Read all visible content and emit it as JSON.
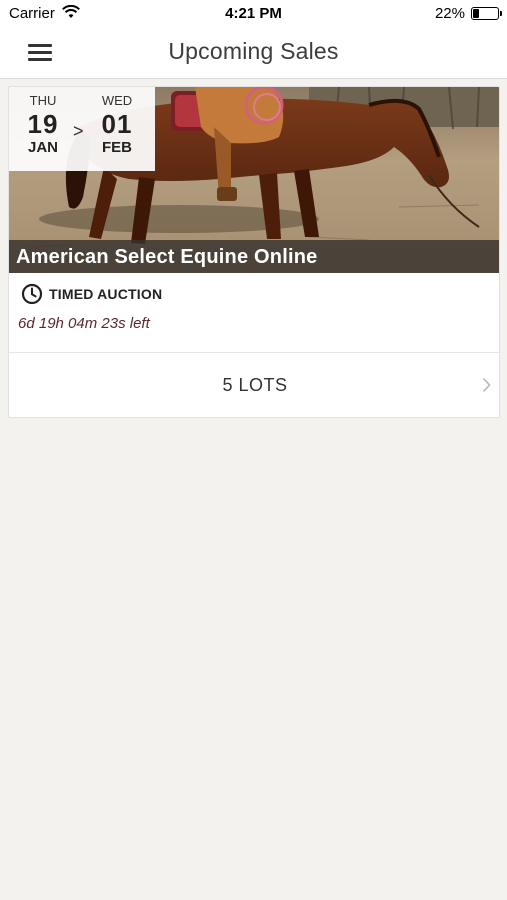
{
  "status_bar": {
    "carrier": "Carrier",
    "time": "4:21 PM",
    "battery_percent": "22%",
    "battery_level": 0.22,
    "wifi_icon": "wifi-icon"
  },
  "nav": {
    "title": "Upcoming Sales",
    "menu_icon": "hamburger-menu-icon"
  },
  "sale": {
    "start": {
      "dow": "THU",
      "day": "19",
      "month": "JAN"
    },
    "arrow": ">",
    "end": {
      "dow": "WED",
      "day": "01",
      "month": "FEB"
    },
    "title": "American Select Equine Online",
    "auction_type": "TIMED AUCTION",
    "auction_icon": "clock-icon",
    "time_left": "6d 19h 04m 23s left",
    "lots_label": "5 LOTS",
    "lots_icon": "chevron-right-icon",
    "image_subject": "saddled bay horse"
  },
  "colors": {
    "background": "#f3f2ef",
    "card": "#ffffff",
    "title_band": "#37322d",
    "time_left_text": "#5a2a2a"
  }
}
